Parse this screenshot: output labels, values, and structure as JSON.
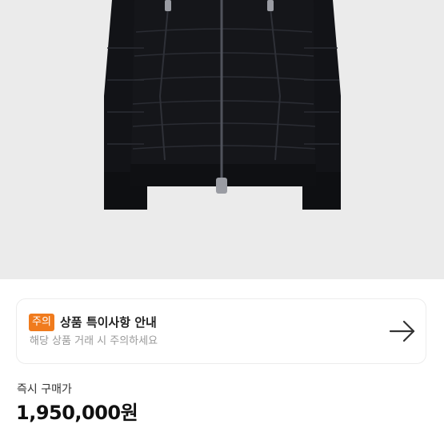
{
  "notice": {
    "badge": "주의",
    "title": "상품 특이사항 안내",
    "subtitle": "해당 상품 거래 시 주의하세요"
  },
  "price": {
    "label": "즉시 구매가",
    "value": "1,950,000원"
  },
  "colors": {
    "image_background": "#ebebeb",
    "badge": "#f07b1d",
    "jacket": "#101114"
  },
  "icons": {
    "notice_arrow": "arrow-right-icon"
  }
}
